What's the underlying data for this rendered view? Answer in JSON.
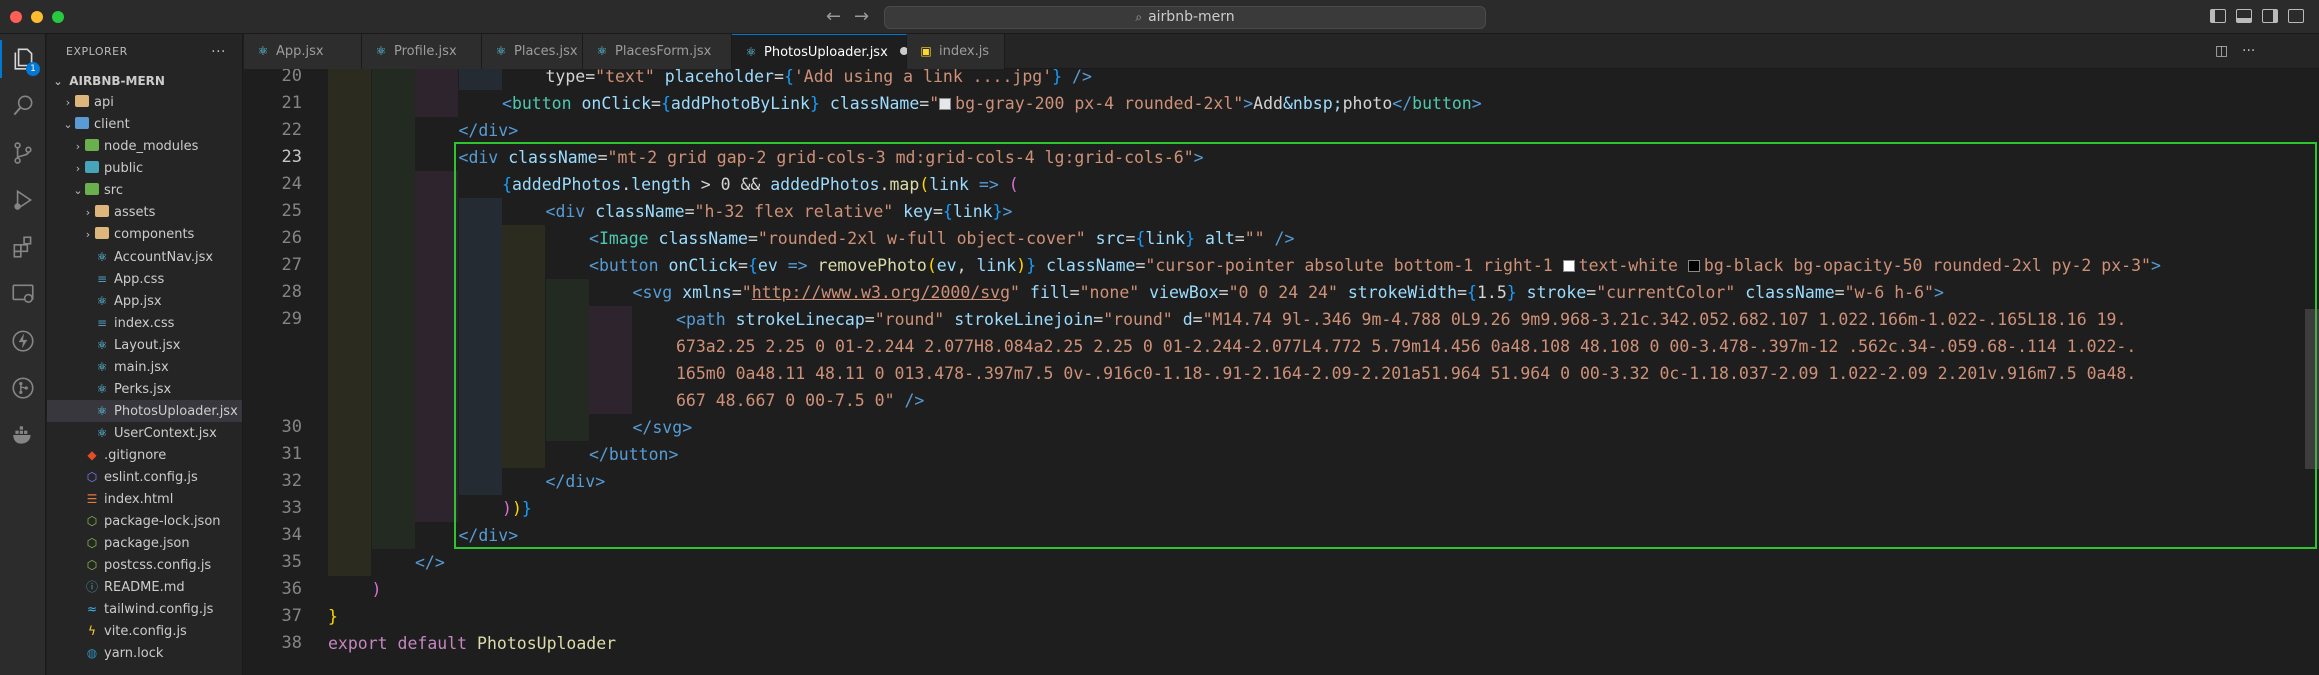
{
  "titlebar": {
    "search_text": "airbnb-mern"
  },
  "activity": {
    "explorer_badge": "1"
  },
  "sidebar": {
    "title": "EXPLORER",
    "more": "···",
    "root": "AIRBNB-MERN",
    "items": [
      {
        "label": "api",
        "depth": 1,
        "kind": "folder",
        "expanded": false
      },
      {
        "label": "client",
        "depth": 1,
        "kind": "folder-blue",
        "expanded": true
      },
      {
        "label": "node_modules",
        "depth": 2,
        "kind": "folder-green",
        "expanded": false
      },
      {
        "label": "public",
        "depth": 2,
        "kind": "folder-teal",
        "expanded": false
      },
      {
        "label": "src",
        "depth": 2,
        "kind": "folder-green",
        "expanded": true
      },
      {
        "label": "assets",
        "depth": 3,
        "kind": "folder",
        "expanded": false
      },
      {
        "label": "components",
        "depth": 3,
        "kind": "folder",
        "expanded": false
      },
      {
        "label": "AccountNav.jsx",
        "depth": 3,
        "kind": "react"
      },
      {
        "label": "App.css",
        "depth": 3,
        "kind": "css"
      },
      {
        "label": "App.jsx",
        "depth": 3,
        "kind": "react"
      },
      {
        "label": "index.css",
        "depth": 3,
        "kind": "css"
      },
      {
        "label": "Layout.jsx",
        "depth": 3,
        "kind": "react"
      },
      {
        "label": "main.jsx",
        "depth": 3,
        "kind": "react"
      },
      {
        "label": "Perks.jsx",
        "depth": 3,
        "kind": "react"
      },
      {
        "label": "PhotosUploader.jsx",
        "depth": 3,
        "kind": "react",
        "selected": true
      },
      {
        "label": "UserContext.jsx",
        "depth": 3,
        "kind": "react"
      },
      {
        "label": ".gitignore",
        "depth": 2,
        "kind": "git"
      },
      {
        "label": "eslint.config.js",
        "depth": 2,
        "kind": "eslint"
      },
      {
        "label": "index.html",
        "depth": 2,
        "kind": "html"
      },
      {
        "label": "package-lock.json",
        "depth": 2,
        "kind": "json"
      },
      {
        "label": "package.json",
        "depth": 2,
        "kind": "json"
      },
      {
        "label": "postcss.config.js",
        "depth": 2,
        "kind": "json"
      },
      {
        "label": "README.md",
        "depth": 2,
        "kind": "info"
      },
      {
        "label": "tailwind.config.js",
        "depth": 2,
        "kind": "tw"
      },
      {
        "label": "vite.config.js",
        "depth": 2,
        "kind": "vite"
      },
      {
        "label": "yarn.lock",
        "depth": 2,
        "kind": "yarn"
      }
    ]
  },
  "tabs": [
    {
      "label": "App.jsx",
      "icon": "react"
    },
    {
      "label": "Profile.jsx",
      "icon": "react"
    },
    {
      "label": "Places.jsx",
      "icon": "react"
    },
    {
      "label": "PlacesForm.jsx",
      "icon": "react"
    },
    {
      "label": "PhotosUploader.jsx",
      "icon": "react",
      "active": true,
      "dirty": true
    },
    {
      "label": "index.js",
      "icon": "js"
    }
  ],
  "editor": {
    "current_line": "23",
    "line_numbers": [
      "20",
      "21",
      "22",
      "23",
      "24",
      "25",
      "26",
      "27",
      "28",
      "29",
      "",
      "",
      "",
      "30",
      "31",
      "32",
      "33",
      "34",
      "35",
      "36",
      "37",
      "38"
    ],
    "lines": [
      {
        "i": 5,
        "t": [
          [
            "pl",
            "type="
          ],
          [
            "s",
            "\"text\""
          ],
          [
            "pl",
            " "
          ],
          [
            "at",
            "placeholder"
          ],
          [
            "pl",
            "="
          ],
          [
            "br3",
            "{"
          ],
          [
            "s",
            "'Add using a link ....jpg'"
          ],
          [
            "br3",
            "}"
          ],
          [
            "pl",
            " "
          ],
          [
            "tg2",
            "/>"
          ]
        ]
      },
      {
        "i": 4,
        "t": [
          [
            "tg2",
            "<"
          ],
          [
            "tg",
            "button"
          ],
          [
            "pl",
            " "
          ],
          [
            "at",
            "onClick"
          ],
          [
            "pl",
            "="
          ],
          [
            "br3",
            "{"
          ],
          [
            "vr",
            "addPhotoByLink"
          ],
          [
            "br3",
            "}"
          ],
          [
            "pl",
            " "
          ],
          [
            "at",
            "className"
          ],
          [
            "pl",
            "="
          ],
          [
            "s",
            "\""
          ],
          [
            "swatch",
            "#e5e7eb"
          ],
          [
            "s",
            "bg-gray-200 px-4 rounded-2xl\""
          ],
          [
            "tg2",
            ">"
          ],
          [
            "txt",
            "Add"
          ],
          [
            "at",
            "&nbsp;"
          ],
          [
            "txt",
            "photo"
          ],
          [
            "tg2",
            "</"
          ],
          [
            "tg",
            "button"
          ],
          [
            "tg2",
            ">"
          ]
        ]
      },
      {
        "i": 3,
        "t": [
          [
            "tg2",
            "</"
          ],
          [
            "tg2",
            "div"
          ],
          [
            "tg2",
            ">"
          ]
        ]
      },
      {
        "i": 3,
        "t": [
          [
            "tg2",
            "<"
          ],
          [
            "tg2",
            "div"
          ],
          [
            "pl",
            " "
          ],
          [
            "at",
            "className"
          ],
          [
            "pl",
            "="
          ],
          [
            "s",
            "\"mt-2 grid gap-2 grid-cols-3 md:grid-cols-4 lg:grid-cols-6\""
          ],
          [
            "tg2",
            ">"
          ]
        ]
      },
      {
        "i": 4,
        "t": [
          [
            "br3",
            "{"
          ],
          [
            "vr",
            "addedPhotos"
          ],
          [
            "pl",
            "."
          ],
          [
            "vr",
            "length"
          ],
          [
            "pl",
            " > "
          ],
          [
            "pl",
            "0 && "
          ],
          [
            "vr",
            "addedPhotos"
          ],
          [
            "pl",
            "."
          ],
          [
            "fn",
            "map"
          ],
          [
            "br",
            "("
          ],
          [
            "vr",
            "link"
          ],
          [
            "pl",
            " "
          ],
          [
            "k",
            "=>"
          ],
          [
            "pl",
            " "
          ],
          [
            "br2",
            "("
          ]
        ]
      },
      {
        "i": 5,
        "t": [
          [
            "tg2",
            "<"
          ],
          [
            "tg2",
            "div"
          ],
          [
            "pl",
            " "
          ],
          [
            "at",
            "className"
          ],
          [
            "pl",
            "="
          ],
          [
            "s",
            "\"h-32 flex relative\""
          ],
          [
            "pl",
            " "
          ],
          [
            "at",
            "key"
          ],
          [
            "pl",
            "="
          ],
          [
            "br3",
            "{"
          ],
          [
            "vr",
            "link"
          ],
          [
            "br3",
            "}"
          ],
          [
            "tg2",
            ">"
          ]
        ]
      },
      {
        "i": 6,
        "t": [
          [
            "tg2",
            "<"
          ],
          [
            "tg",
            "Image"
          ],
          [
            "pl",
            " "
          ],
          [
            "at",
            "className"
          ],
          [
            "pl",
            "="
          ],
          [
            "s",
            "\"rounded-2xl w-full object-cover\""
          ],
          [
            "pl",
            " "
          ],
          [
            "at",
            "src"
          ],
          [
            "pl",
            "="
          ],
          [
            "br3",
            "{"
          ],
          [
            "vr",
            "link"
          ],
          [
            "br3",
            "}"
          ],
          [
            "pl",
            " "
          ],
          [
            "at",
            "alt"
          ],
          [
            "pl",
            "="
          ],
          [
            "s",
            "\"\""
          ],
          [
            "pl",
            " "
          ],
          [
            "tg2",
            "/>"
          ]
        ]
      },
      {
        "i": 6,
        "t": [
          [
            "tg2",
            "<"
          ],
          [
            "tg2",
            "button"
          ],
          [
            "pl",
            " "
          ],
          [
            "at",
            "onClick"
          ],
          [
            "pl",
            "="
          ],
          [
            "br3",
            "{"
          ],
          [
            "vr",
            "ev"
          ],
          [
            "pl",
            " "
          ],
          [
            "k",
            "=>"
          ],
          [
            "pl",
            " "
          ],
          [
            "fn",
            "removePhoto"
          ],
          [
            "br",
            "("
          ],
          [
            "vr",
            "ev"
          ],
          [
            "pl",
            ", "
          ],
          [
            "vr",
            "link"
          ],
          [
            "br",
            ")"
          ],
          [
            "br3",
            "}"
          ],
          [
            "pl",
            " "
          ],
          [
            "at",
            "className"
          ],
          [
            "pl",
            "="
          ],
          [
            "s",
            "\"cursor-pointer absolute bottom-1 right-1 "
          ],
          [
            "swatch",
            "#ffffff"
          ],
          [
            "s",
            "text-white "
          ],
          [
            "swatch",
            "#000000"
          ],
          [
            "s",
            "bg-black bg-opacity-50 rounded-2xl py-2 px-3\""
          ],
          [
            "tg2",
            ">"
          ]
        ]
      },
      {
        "i": 7,
        "t": [
          [
            "tg2",
            "<"
          ],
          [
            "tg2",
            "svg"
          ],
          [
            "pl",
            " "
          ],
          [
            "at",
            "xmlns"
          ],
          [
            "pl",
            "="
          ],
          [
            "s",
            "\""
          ],
          [
            "url",
            "http://www.w3.org/2000/svg"
          ],
          [
            "s",
            "\""
          ],
          [
            "pl",
            " "
          ],
          [
            "at",
            "fill"
          ],
          [
            "pl",
            "="
          ],
          [
            "s",
            "\"none\""
          ],
          [
            "pl",
            " "
          ],
          [
            "at",
            "viewBox"
          ],
          [
            "pl",
            "="
          ],
          [
            "s",
            "\"0 0 24 24\""
          ],
          [
            "pl",
            " "
          ],
          [
            "at",
            "strokeWidth"
          ],
          [
            "pl",
            "="
          ],
          [
            "br3",
            "{"
          ],
          [
            "pl",
            "1.5"
          ],
          [
            "br3",
            "}"
          ],
          [
            "pl",
            " "
          ],
          [
            "at",
            "stroke"
          ],
          [
            "pl",
            "="
          ],
          [
            "s",
            "\"currentColor\""
          ],
          [
            "pl",
            " "
          ],
          [
            "at",
            "className"
          ],
          [
            "pl",
            "="
          ],
          [
            "s",
            "\"w-6 h-6\""
          ],
          [
            "tg2",
            ">"
          ]
        ]
      },
      {
        "i": 8,
        "t": [
          [
            "tg2",
            "<"
          ],
          [
            "tg2",
            "path"
          ],
          [
            "pl",
            " "
          ],
          [
            "at",
            "strokeLinecap"
          ],
          [
            "pl",
            "="
          ],
          [
            "s",
            "\"round\""
          ],
          [
            "pl",
            " "
          ],
          [
            "at",
            "strokeLinejoin"
          ],
          [
            "pl",
            "="
          ],
          [
            "s",
            "\"round\""
          ],
          [
            "pl",
            " "
          ],
          [
            "at",
            "d"
          ],
          [
            "pl",
            "="
          ],
          [
            "s",
            "\"M14.74 9l-.346 9m-4.788 0L9.26 9m9.968-3.21c.342.052.682.107 1.022.166m-1.022-.165L18.16 19."
          ]
        ]
      },
      {
        "i": 8,
        "t": [
          [
            "s",
            "673a2.25 2.25 0 01-2.244 2.077H8.084a2.25 2.25 0 01-2.244-2.077L4.772 5.79m14.456 0a48.108 48.108 0 00-3.478-.397m-12 .562c.34-.059.68-.114 1.022-."
          ]
        ]
      },
      {
        "i": 8,
        "t": [
          [
            "s",
            "165m0 0a48.11 48.11 0 013.478-.397m7.5 0v-.916c0-1.18-.91-2.164-2.09-2.201a51.964 51.964 0 00-3.32 0c-1.18.037-2.09 1.022-2.09 2.201v.916m7.5 0a48."
          ]
        ]
      },
      {
        "i": 8,
        "t": [
          [
            "s",
            "667 48.667 0 00-7.5 0\""
          ],
          [
            "pl",
            " "
          ],
          [
            "tg2",
            "/>"
          ]
        ]
      },
      {
        "i": 7,
        "t": [
          [
            "tg2",
            "</"
          ],
          [
            "tg2",
            "svg"
          ],
          [
            "tg2",
            ">"
          ]
        ]
      },
      {
        "i": 6,
        "t": [
          [
            "tg2",
            "</"
          ],
          [
            "tg2",
            "button"
          ],
          [
            "tg2",
            ">"
          ]
        ]
      },
      {
        "i": 5,
        "t": [
          [
            "tg2",
            "</"
          ],
          [
            "tg2",
            "div"
          ],
          [
            "tg2",
            ">"
          ]
        ]
      },
      {
        "i": 4,
        "t": [
          [
            "br2",
            ")"
          ],
          [
            "br",
            ")"
          ],
          [
            "br3",
            "}"
          ]
        ]
      },
      {
        "i": 3,
        "t": [
          [
            "tg2",
            "</"
          ],
          [
            "tg2",
            "div"
          ],
          [
            "tg2",
            ">"
          ]
        ]
      },
      {
        "i": 2,
        "t": [
          [
            "tg2",
            "</>"
          ]
        ]
      },
      {
        "i": 1,
        "t": [
          [
            "br2",
            ")"
          ]
        ]
      },
      {
        "i": 0,
        "t": [
          [
            "br",
            "}"
          ]
        ]
      },
      {
        "i": 0,
        "t": [
          [
            "kw",
            "export"
          ],
          [
            "pl",
            " "
          ],
          [
            "kw",
            "default"
          ],
          [
            "pl",
            " "
          ],
          [
            "fn",
            "PhotosUploader"
          ]
        ]
      }
    ]
  }
}
